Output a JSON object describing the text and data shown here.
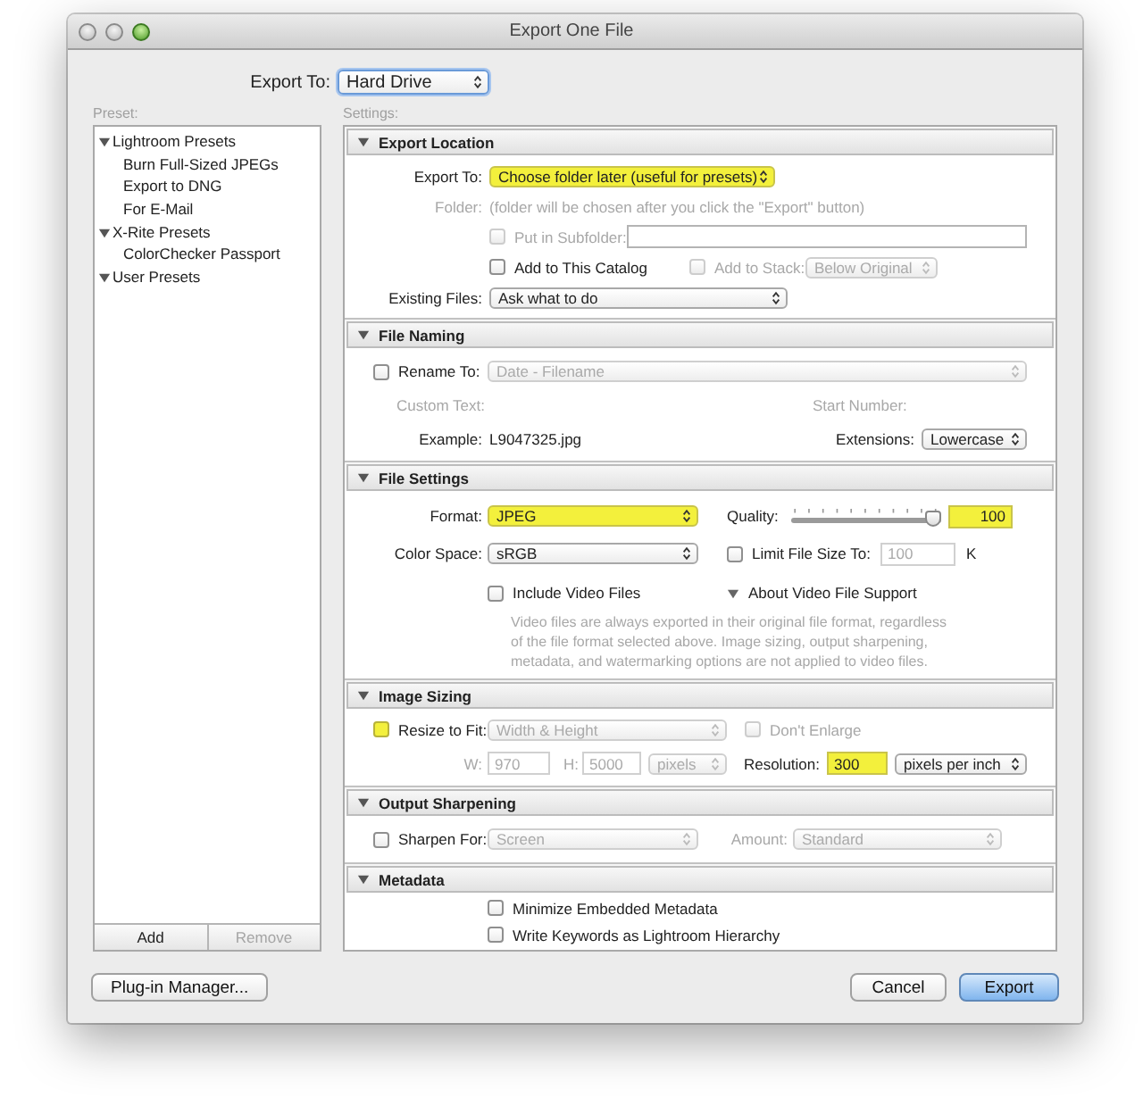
{
  "window": {
    "title": "Export One File"
  },
  "export_to": {
    "label": "Export To:",
    "value": "Hard Drive"
  },
  "preset": {
    "label": "Preset:",
    "groups": [
      {
        "name": "Lightroom Presets",
        "expanded": true,
        "children": [
          {
            "name": "Burn Full-Sized JPEGs"
          },
          {
            "name": "Export to DNG"
          },
          {
            "name": "For E-Mail"
          }
        ]
      },
      {
        "name": "X-Rite Presets",
        "expanded": true,
        "children": [
          {
            "name": "ColorChecker Passport"
          }
        ]
      },
      {
        "name": "User Presets",
        "expanded": true
      }
    ],
    "buttons": [
      {
        "label": "Add",
        "disabled": false
      },
      {
        "label": "Remove",
        "disabled": true
      }
    ]
  },
  "settings": {
    "label": "Settings:",
    "sections": [
      {
        "title": "Export Location",
        "expanded": true,
        "rows": [
          {
            "left": [
              {
                "kind": "label",
                "text": "Export To:",
                "disabled": false
              },
              {
                "kind": "select",
                "text": "Choose folder later (useful for presets)",
                "disabled": false,
                "highlighted": true
              }
            ]
          },
          {
            "left": [
              {
                "kind": "label",
                "text": "Folder:",
                "disabled": true
              },
              {
                "kind": "text",
                "text": "(folder will be chosen after you click the \"Export\" button)",
                "disabled": true
              }
            ]
          },
          {
            "left": [
              {
                "kind": "checkbox",
                "text": "Put in Subfolder:",
                "checked": false,
                "disabled": true,
                "highlighted": false
              },
              {
                "kind": "input",
                "disabled": false,
                "highlighted": false
              }
            ]
          },
          {
            "left": [
              {
                "kind": "checkbox",
                "text": "Add to This Catalog",
                "checked": false,
                "disabled": false,
                "highlighted": false
              }
            ],
            "right": [
              {
                "kind": "checkbox",
                "text": "Add to Stack:",
                "checked": false,
                "disabled": true,
                "highlighted": false
              },
              {
                "kind": "select",
                "text": "Below Original",
                "disabled": true,
                "highlighted": false
              }
            ]
          },
          {
            "left": [
              {
                "kind": "label",
                "text": "Existing Files:",
                "disabled": false
              },
              {
                "kind": "select",
                "text": "Ask what to do",
                "disabled": false,
                "highlighted": false
              }
            ]
          }
        ]
      },
      {
        "title": "File Naming",
        "expanded": true,
        "rows": [
          {
            "left": [
              {
                "kind": "checkbox",
                "text": "Rename To:",
                "checked": false,
                "disabled": false,
                "highlighted": false
              },
              {
                "kind": "select",
                "text": "Date - Filename",
                "disabled": true,
                "highlighted": false
              }
            ]
          },
          {
            "left": [
              {
                "kind": "text",
                "text": "Custom Text:",
                "disabled": true
              }
            ],
            "right": [
              {
                "kind": "text",
                "text": "Start Number:",
                "disabled": true
              }
            ]
          },
          {
            "left": [
              {
                "kind": "label",
                "text": "Example:",
                "disabled": false
              },
              {
                "kind": "text",
                "text": "L9047325.jpg",
                "disabled": false
              }
            ],
            "right": [
              {
                "kind": "label",
                "text": "Extensions:",
                "disabled": false
              },
              {
                "kind": "select",
                "text": "Lowercase",
                "disabled": false,
                "highlighted": false
              }
            ]
          }
        ]
      },
      {
        "title": "File Settings",
        "expanded": true,
        "rows": [
          {
            "left": [
              {
                "kind": "label",
                "text": "Format:",
                "disabled": false
              },
              {
                "kind": "select",
                "text": "JPEG",
                "disabled": false,
                "highlighted": true
              }
            ],
            "right": [
              {
                "kind": "text",
                "text": "Quality:",
                "disabled": false
              },
              {
                "kind": "slider",
                "level": 1
              },
              {
                "kind": "input",
                "text": "100",
                "disabled": false,
                "highlighted": true
              }
            ]
          },
          {
            "left": [
              {
                "kind": "label",
                "text": "Color Space:",
                "disabled": false
              },
              {
                "kind": "select",
                "text": "sRGB",
                "disabled": false,
                "highlighted": false
              }
            ],
            "right": [
              {
                "kind": "checkbox",
                "text": "Limit File Size To:",
                "checked": false,
                "disabled": false,
                "highlighted": false
              },
              {
                "kind": "input",
                "text": "100",
                "disabled": true,
                "highlighted": false
              },
              {
                "kind": "text",
                "text": "K",
                "disabled": false
              }
            ]
          },
          {
            "left": [
              {
                "kind": "checkbox",
                "text": "Include Video Files",
                "checked": false,
                "disabled": false,
                "highlighted": false
              }
            ],
            "right": [
              {
                "kind": "disclosure",
                "text": "About Video File Support",
                "expanded": true
              }
            ]
          },
          {
            "left": [
              {
                "kind": "note",
                "text": "Video files are always exported in their original file format, regardless of the file format selected above. Image sizing, output sharpening, metadata, and watermarking options are not applied to video files.",
                "disabled": true
              }
            ]
          }
        ]
      },
      {
        "title": "Image Sizing",
        "expanded": true,
        "rows": [
          {
            "left": [
              {
                "kind": "checkbox",
                "text": "Resize to Fit:",
                "checked": false,
                "disabled": false,
                "highlighted": true
              },
              {
                "kind": "select",
                "text": "Width & Height",
                "disabled": true,
                "highlighted": false
              }
            ],
            "right": [
              {
                "kind": "checkbox",
                "text": "Don't Enlarge",
                "checked": false,
                "disabled": true,
                "highlighted": false
              }
            ]
          },
          {
            "left": [
              {
                "kind": "label",
                "text": "W:",
                "disabled": true
              },
              {
                "kind": "input",
                "text": "970",
                "disabled": true,
                "highlighted": false
              },
              {
                "kind": "label",
                "text": "H:",
                "disabled": true
              },
              {
                "kind": "input",
                "text": "5000",
                "disabled": true,
                "highlighted": false
              },
              {
                "kind": "select",
                "text": "pixels",
                "disabled": true,
                "highlighted": false
              }
            ],
            "right": [
              {
                "kind": "label",
                "text": "Resolution:",
                "disabled": false
              },
              {
                "kind": "input",
                "text": "300",
                "disabled": false,
                "highlighted": true
              },
              {
                "kind": "select",
                "text": "pixels per inch",
                "disabled": false,
                "highlighted": false
              }
            ]
          }
        ]
      },
      {
        "title": "Output Sharpening",
        "expanded": true,
        "rows": [
          {
            "left": [
              {
                "kind": "checkbox",
                "text": "Sharpen For:",
                "checked": false,
                "disabled": false,
                "highlighted": false
              },
              {
                "kind": "select",
                "text": "Screen",
                "disabled": true,
                "highlighted": false
              }
            ],
            "right": [
              {
                "kind": "label",
                "text": "Amount:",
                "disabled": true
              },
              {
                "kind": "select",
                "text": "Standard",
                "disabled": true,
                "highlighted": false
              }
            ]
          }
        ]
      },
      {
        "title": "Metadata",
        "expanded": true,
        "rows": [
          {
            "left": [
              {
                "kind": "checkbox",
                "text": "Minimize Embedded Metadata",
                "checked": false,
                "disabled": false,
                "highlighted": false
              }
            ]
          },
          {
            "left": [
              {
                "kind": "checkbox",
                "text": "Write Keywords as Lightroom Hierarchy",
                "checked": false,
                "disabled": false,
                "highlighted": false
              }
            ]
          }
        ]
      }
    ]
  },
  "footer": {
    "left_button": "Plug-in Manager...",
    "buttons": [
      {
        "label": "Cancel",
        "default": false
      },
      {
        "label": "Export",
        "default": true
      }
    ]
  }
}
